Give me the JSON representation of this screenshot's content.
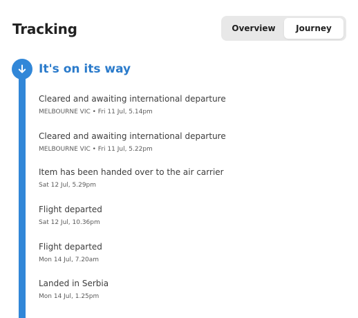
{
  "header": {
    "title": "Tracking",
    "tabs": [
      {
        "label": "Overview",
        "selected": false
      },
      {
        "label": "Journey",
        "selected": true
      }
    ]
  },
  "status": {
    "heading": "It's on its way",
    "icon": "arrow-down-icon",
    "color": "#3187d8"
  },
  "events": [
    {
      "title": "Cleared and awaiting international departure",
      "meta": "MELBOURNE VIC • Fri 11 Jul, 5.14pm"
    },
    {
      "title": "Cleared and awaiting international departure",
      "meta": "MELBOURNE VIC • Fri 11 Jul, 5.22pm"
    },
    {
      "title": "Item has been handed over to the air carrier",
      "meta": "Sat 12 Jul, 5.29pm"
    },
    {
      "title": "Flight departed",
      "meta": "Sat 12 Jul, 10.36pm"
    },
    {
      "title": "Flight departed",
      "meta": "Mon 14 Jul, 7.20am"
    },
    {
      "title": "Landed in Serbia",
      "meta": "Mon 14 Jul, 1.25pm"
    }
  ]
}
